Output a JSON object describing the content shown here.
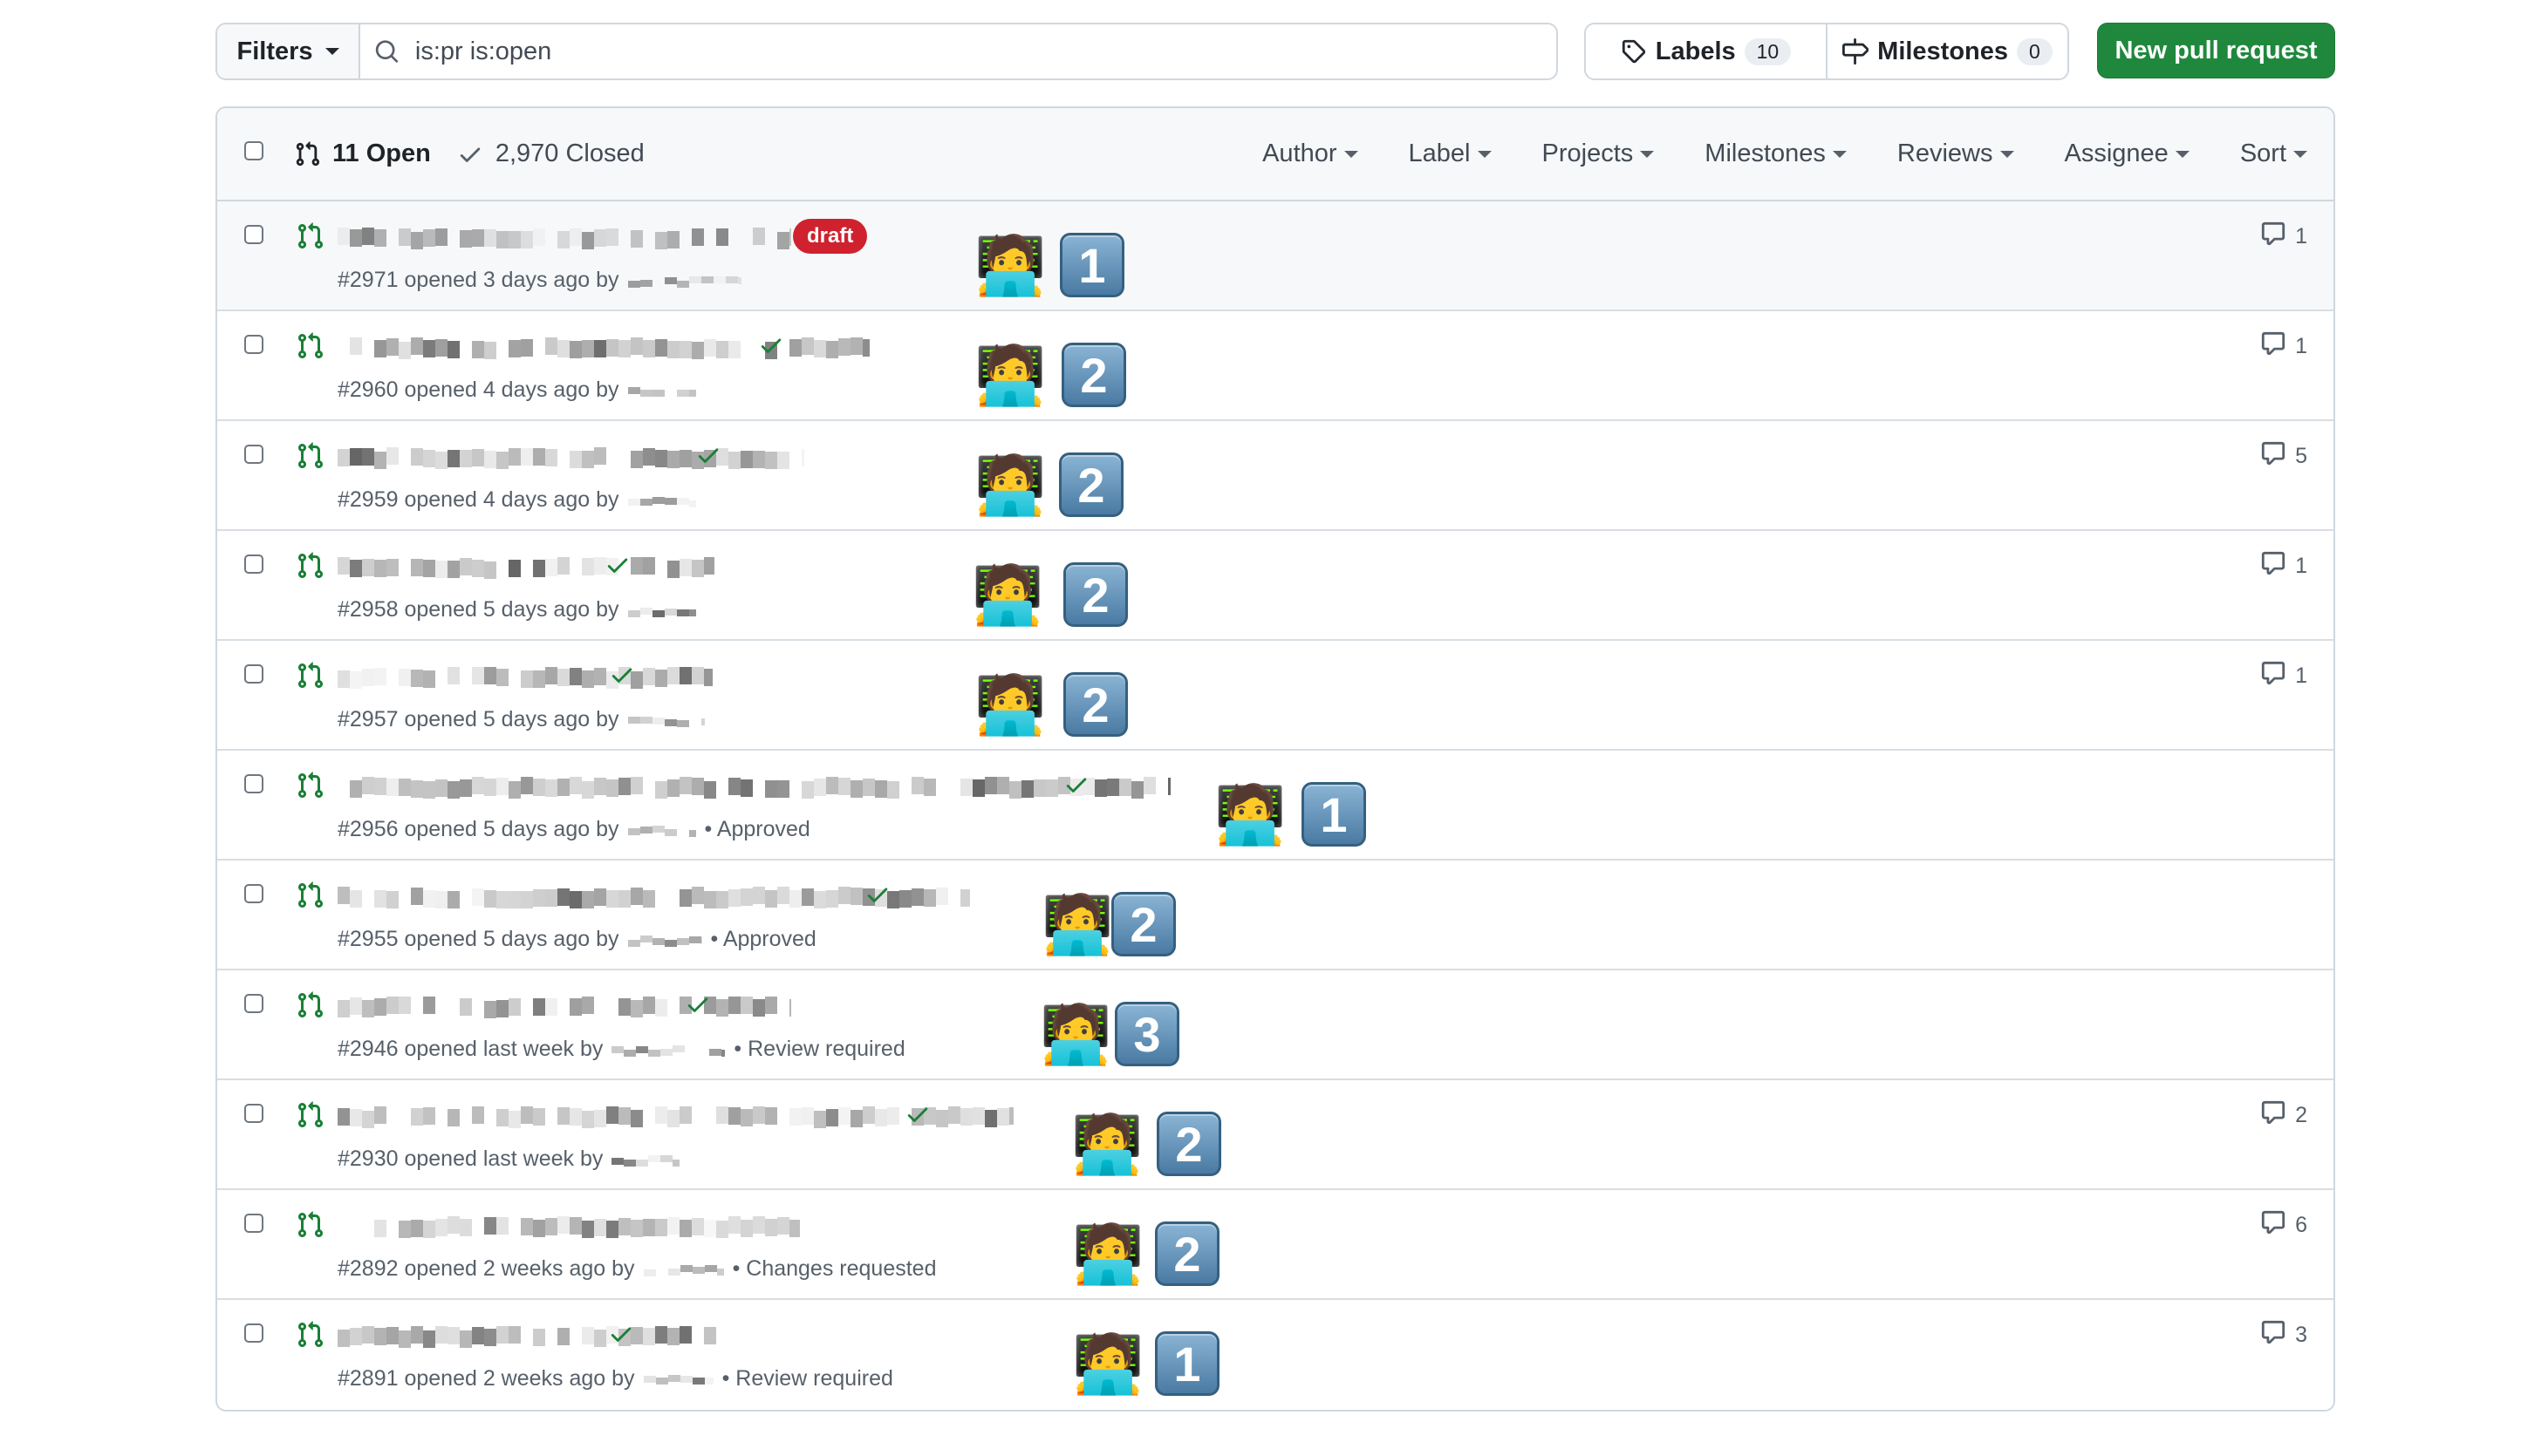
{
  "toolbar": {
    "filters_label": "Filters",
    "search_value": "is:pr is:open",
    "labels_label": "Labels",
    "labels_count": "10",
    "milestones_label": "Milestones",
    "milestones_count": "0",
    "new_pr_label": "New pull request"
  },
  "list_header": {
    "open_label": "11 Open",
    "closed_label": "2,970 Closed",
    "filters": [
      "Author",
      "Label",
      "Projects",
      "Milestones",
      "Reviews",
      "Assignee",
      "Sort"
    ]
  },
  "colors": {
    "open_icon": "#1a7f37",
    "primary_button": "#1f883d",
    "draft": "#cf222e",
    "check": "#1a7f37"
  },
  "icons": {
    "search": "search-icon",
    "tag": "tag-icon",
    "milestone": "milestone-icon",
    "pr_open": "git-pull-request-icon",
    "closed": "check-icon",
    "comment": "comment-icon",
    "emoji": "technologist-emoji",
    "keycap": "keycap-number"
  },
  "prs": [
    {
      "meta": "#2971 opened 3 days ago by",
      "status": "",
      "draft": "draft",
      "check": false,
      "keycap": "1",
      "comments": "1"
    },
    {
      "meta": "#2960 opened 4 days ago by",
      "status": "",
      "draft": "",
      "check": true,
      "keycap": "2",
      "comments": "1"
    },
    {
      "meta": "#2959 opened 4 days ago by",
      "status": "",
      "draft": "",
      "check": true,
      "keycap": "2",
      "comments": "5"
    },
    {
      "meta": "#2958 opened 5 days ago by",
      "status": "",
      "draft": "",
      "check": true,
      "keycap": "2",
      "comments": "1"
    },
    {
      "meta": "#2957 opened 5 days ago by",
      "status": "",
      "draft": "",
      "check": true,
      "keycap": "2",
      "comments": "1"
    },
    {
      "meta": "#2956 opened 5 days ago by",
      "status": "• Approved",
      "draft": "",
      "check": true,
      "keycap": "1",
      "comments": ""
    },
    {
      "meta": "#2955 opened 5 days ago by",
      "status": "• Approved",
      "draft": "",
      "check": true,
      "keycap": "2",
      "comments": ""
    },
    {
      "meta": "#2946 opened last week by",
      "status": "• Review required",
      "draft": "",
      "check": true,
      "keycap": "3",
      "comments": ""
    },
    {
      "meta": "#2930 opened last week by",
      "status": "",
      "draft": "",
      "check": true,
      "keycap": "2",
      "comments": "2"
    },
    {
      "meta": "#2892 opened 2 weeks ago by",
      "status": "• Changes requested",
      "draft": "",
      "check": false,
      "keycap": "2",
      "comments": "6"
    },
    {
      "meta": "#2891 opened 2 weeks ago by",
      "status": "• Review required",
      "draft": "",
      "check": true,
      "keycap": "1",
      "comments": "3"
    }
  ]
}
